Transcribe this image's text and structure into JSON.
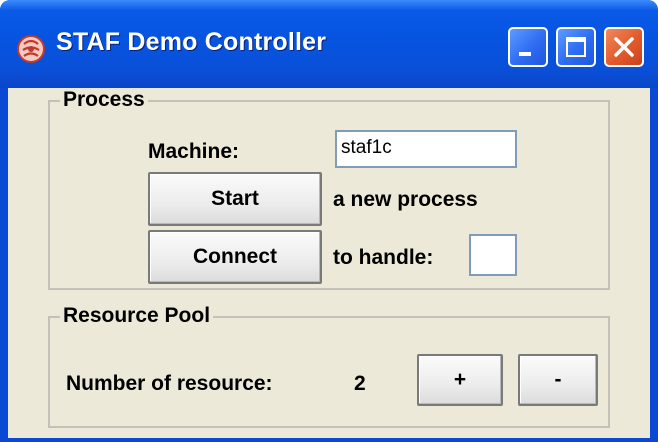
{
  "window": {
    "title": "STAF Demo Controller",
    "buttons": {
      "minimize": "minimize-icon",
      "maximize": "maximize-icon",
      "close": "close-icon"
    }
  },
  "process": {
    "group_label": "Process",
    "machine_label": "Machine:",
    "machine_value": "staf1c",
    "start_button": "Start",
    "start_text": "a new process",
    "connect_button": "Connect",
    "connect_text": "to handle:",
    "handle_value": ""
  },
  "resource_pool": {
    "group_label": "Resource Pool",
    "count_label": "Number of resource:",
    "count_value": "2",
    "plus_button": "+",
    "minus_button": "-"
  },
  "colors": {
    "titlebar": "#0654e0",
    "client_bg": "#ece9d8",
    "close_button": "#e25a2c"
  }
}
